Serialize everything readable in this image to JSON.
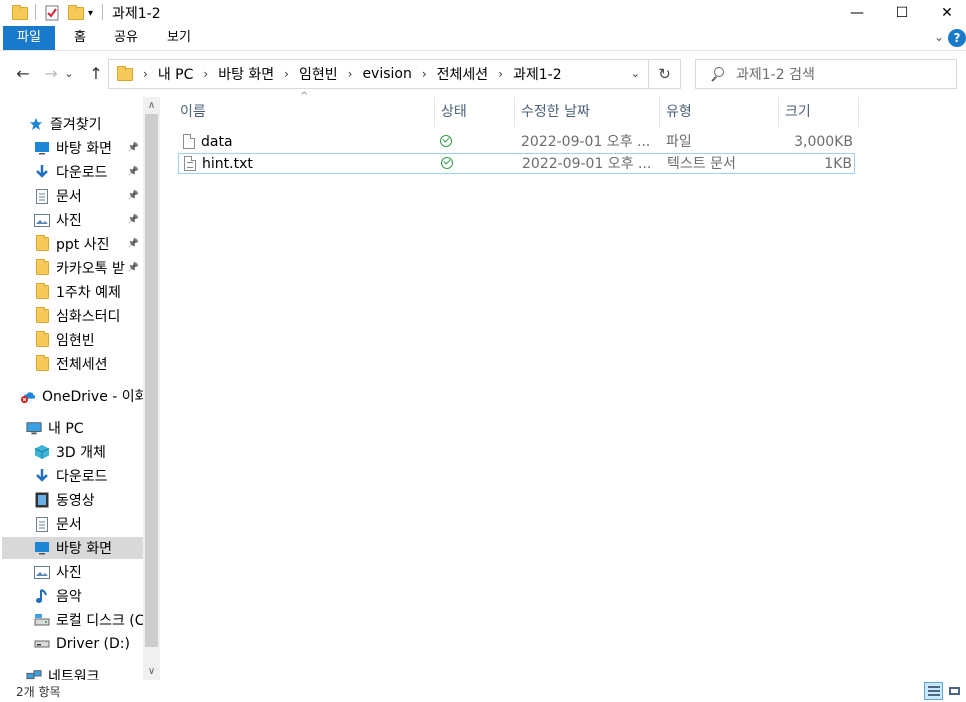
{
  "window": {
    "title": "과제1-2",
    "minimize_glyph": "—",
    "maximize_glyph": "☐",
    "close_glyph": "✕"
  },
  "ribbon": {
    "tabs": [
      {
        "label": "파일"
      },
      {
        "label": "홈"
      },
      {
        "label": "공유"
      },
      {
        "label": "보기"
      }
    ],
    "help_label": "?"
  },
  "nav": {
    "back_glyph": "←",
    "forward_glyph": "→",
    "recent_glyph": "⌄",
    "up_glyph": "↑"
  },
  "address": {
    "segments": [
      "내 PC",
      "바탕 화면",
      "임현빈",
      "evision",
      "전체세션",
      "과제1-2"
    ],
    "refresh_glyph": "↻"
  },
  "search": {
    "placeholder": "과제1-2 검색"
  },
  "navpane": {
    "items": [
      {
        "label": "즐겨찾기",
        "icon": "star-icon"
      },
      {
        "label": "바탕 화면",
        "icon": "desktop-icon"
      },
      {
        "label": "다운로드",
        "icon": "download-icon"
      },
      {
        "label": "문서",
        "icon": "document-icon"
      },
      {
        "label": "사진",
        "icon": "picture-icon"
      },
      {
        "label": "ppt 사진",
        "icon": "folder-icon"
      },
      {
        "label": "카카오톡 받",
        "icon": "folder-icon"
      },
      {
        "label": "1주차 예제",
        "icon": "folder-icon"
      },
      {
        "label": "심화스터디",
        "icon": "folder-icon"
      },
      {
        "label": "임현빈",
        "icon": "folder-icon"
      },
      {
        "label": "전체세션",
        "icon": "folder-icon"
      },
      {
        "label": "OneDrive - 이화",
        "icon": "onedrive-icon"
      },
      {
        "label": "내 PC",
        "icon": "pc-icon"
      },
      {
        "label": "3D 개체",
        "icon": "3d-objects-icon"
      },
      {
        "label": "다운로드",
        "icon": "download-icon"
      },
      {
        "label": "동영상",
        "icon": "video-icon"
      },
      {
        "label": "문서",
        "icon": "document-icon"
      },
      {
        "label": "바탕 화면",
        "icon": "desktop-icon"
      },
      {
        "label": "사진",
        "icon": "picture-icon"
      },
      {
        "label": "음악",
        "icon": "music-icon"
      },
      {
        "label": "로컬 디스크 (C",
        "icon": "disk-icon"
      },
      {
        "label": "Driver (D:)",
        "icon": "drive-icon"
      },
      {
        "label": "네트워크",
        "icon": "network-icon"
      }
    ]
  },
  "columns": {
    "name": "이름",
    "status": "상태",
    "modified": "수정한 날짜",
    "type": "유형",
    "size": "크기"
  },
  "files": [
    {
      "name": "data",
      "modified": "2022-09-01 오후 ...",
      "type": "파일",
      "size": "3,000KB"
    },
    {
      "name": "hint.txt",
      "modified": "2022-09-01 오후 ...",
      "type": "텍스트 문서",
      "size": "1KB"
    }
  ],
  "statusbar": {
    "item_count": "2개 항목"
  }
}
